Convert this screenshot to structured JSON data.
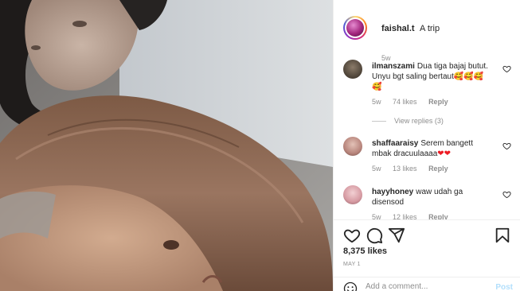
{
  "post": {
    "username": "faishal.t",
    "caption": "A trip",
    "age": "5w",
    "likes": "8,375 likes",
    "date": "MAY 1"
  },
  "comments": [
    {
      "username": "ilmanszami",
      "text": "Dua tiga bajaj butut. Unyu bgt saling bertaut🥰🥰🥰🥰",
      "age": "5w",
      "likes": "74 likes",
      "reply": "Reply",
      "view_replies": "View replies (3)",
      "avatar_color": "#4b4136"
    },
    {
      "username": "shaffaaraisy",
      "text": "Serem bangett mbak dracuulaaaa",
      "hearts": "❤❤",
      "age": "5w",
      "likes": "13 likes",
      "reply": "Reply",
      "avatar_color": "#b8857c"
    },
    {
      "username": "hayyhoney",
      "text": "waw udah ga disensod",
      "age": "5w",
      "likes": "12 likes",
      "reply": "Reply",
      "avatar_color": "#d69aa2"
    }
  ],
  "add_comment": {
    "placeholder": "Add a comment...",
    "post_label": "Post"
  },
  "icons": {
    "like": "heart-outline-icon",
    "comment": "speech-bubble-icon",
    "share": "paper-plane-icon",
    "save": "bookmark-icon",
    "emoji": "smiley-icon"
  },
  "colors": {
    "text": "#262626",
    "secondary": "#8e8e8e",
    "post_button_disabled": "#b2dffc",
    "divider": "#efefef"
  }
}
